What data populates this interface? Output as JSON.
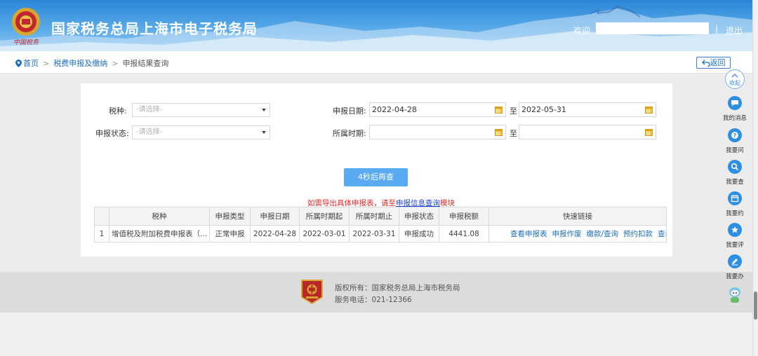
{
  "header": {
    "title": "国家税务总局上海市电子税务局",
    "logo_text": "中国税务",
    "welcome": "欢迎,",
    "separator": "|",
    "logout": "退出"
  },
  "breadcrumb": {
    "home": "首页",
    "level1": "税费申报及缴纳",
    "level2": "申报结果查询",
    "separator": ">"
  },
  "back_button": "返回",
  "form": {
    "tax_type_label": "税种:",
    "tax_type_placeholder": "-请选择-",
    "status_label": "申报状态:",
    "status_placeholder": "-请选择-",
    "date_label": "申报日期:",
    "date_from": "2022-04-28",
    "date_to": "2022-05-31",
    "period_label": "所属时期:",
    "period_from": "",
    "period_to": "",
    "to": "至"
  },
  "search_button": "4秒后再查",
  "notice": {
    "before": "如需导出具体申报表，请至",
    "link": "申报信息查询",
    "after": "模块"
  },
  "table": {
    "headers": [
      "",
      "税种",
      "申报类型",
      "申报日期",
      "所属时期起",
      "所属时期止",
      "申报状态",
      "申报税额",
      "快速链接"
    ],
    "rows": [
      {
        "no": "1",
        "tax_type": "增值税及附加税费申报表（...",
        "type": "正常申报",
        "date": "2022-04-28",
        "start": "2022-03-01",
        "end": "2022-03-31",
        "status": "申报成功",
        "amount": "4441.08",
        "links": [
          "查看申报表",
          "申报作废",
          "缴款/查询",
          "预约扣款",
          "查看"
        ]
      }
    ]
  },
  "footer": {
    "copyright": "版权所有：国家税务总局上海市税务局",
    "phone": "服务电话：021-12366"
  },
  "sidebar": {
    "collapse": "收起",
    "items": [
      {
        "label": "我的消息",
        "icon": "message-icon"
      },
      {
        "label": "我要问",
        "icon": "question-icon"
      },
      {
        "label": "我要查",
        "icon": "search-icon"
      },
      {
        "label": "我要约",
        "icon": "calendar-icon"
      },
      {
        "label": "我要评",
        "icon": "rating-icon"
      },
      {
        "label": "我要办",
        "icon": "edit-icon"
      }
    ],
    "robot_icon": "robot-assistant-icon"
  },
  "colors": {
    "header_blue": "#2a86d6",
    "accent_blue": "#1e6fc1",
    "button_blue": "#5aaaf1",
    "notice_red": "#e02828",
    "side_icon_blue": "#2e8fe0"
  }
}
